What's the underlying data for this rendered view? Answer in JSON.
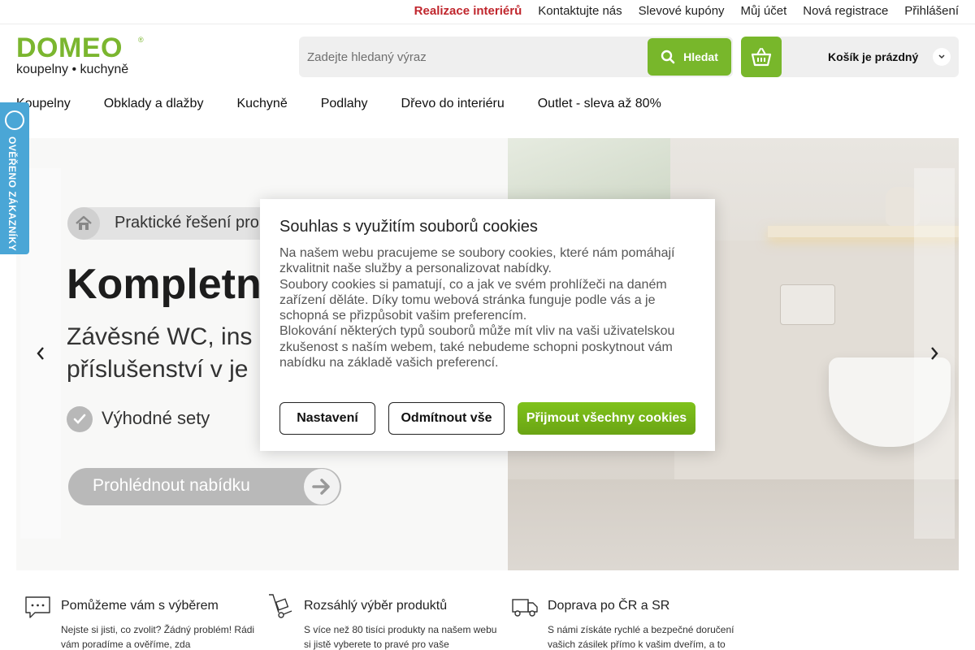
{
  "topbar": {
    "links": [
      "Realizace interiérů",
      "Kontaktujte nás",
      "Slevové kupóny",
      "Můj účet",
      "Nová registrace",
      "Přihlášení"
    ]
  },
  "logo": {
    "word": "DOMEO",
    "tagline": "koupelny • kuchyně"
  },
  "search": {
    "placeholder": "Zadejte hledaný výraz",
    "button_label": "Hledat"
  },
  "cart": {
    "label": "Košík je prázdný"
  },
  "nav": [
    "Koupelny",
    "Obklady a dlažby",
    "Kuchyně",
    "Podlahy",
    "Dřevo do interiéru",
    "Outlet - sleva až 80%"
  ],
  "badge": {
    "text": "OVĚŘENO ZÁKAZNÍKY"
  },
  "hero": {
    "tag": "Praktické řešení pro",
    "title": "Kompletn",
    "line1": "Závěsné WC, ins",
    "line2": "příslušenství v je",
    "bullet": "Výhodné sety",
    "cta": "Prohlédnout nabídku"
  },
  "cookie": {
    "title": "Souhlas s využitím souborů cookies",
    "paragraphs": [
      "Na našem webu pracujeme se soubory cookies, které nám pomáhají zkvalitnit naše služby a personalizovat nabídky.",
      "Soubory cookies si pamatují, co a jak ve svém prohlížeči na daném zařízení děláte. Díky tomu webová stránka funguje podle vás a je schopná se přizpůsobit vašim preferencím.",
      "Blokování některých typů souborů může mít vliv na vaši uživatelskou zkušenost s naším webem, také nebudeme schopni poskytnout vám nabídku na základě vašich preferencí."
    ],
    "btn_settings": "Nastavení",
    "btn_reject": "Odmítnout vše",
    "btn_accept": "Přijmout všechny cookies"
  },
  "features": [
    {
      "icon": "chat-icon",
      "title": "Pomůžeme vám s výběrem",
      "text": "Nejste si jisti, co zvolit? Žádný problém! Rádi vám poradíme a ověříme, zda"
    },
    {
      "icon": "hand-truck-icon",
      "title": "Rozsáhlý výběr produktů",
      "text": "S více než 80 tisíci produkty na našem webu si jistě vyberete to pravé pro vaše"
    },
    {
      "icon": "delivery-truck-icon",
      "title": "Doprava po ČR a SR",
      "text": "S námi získáte rychlé a bezpečné doručení vašich zásilek přímo k vašim dveřím, a to"
    }
  ],
  "colors": {
    "brand_green": "#78b72b",
    "highlight_red": "#c0262d",
    "badge_blue": "#4aa6d6"
  }
}
